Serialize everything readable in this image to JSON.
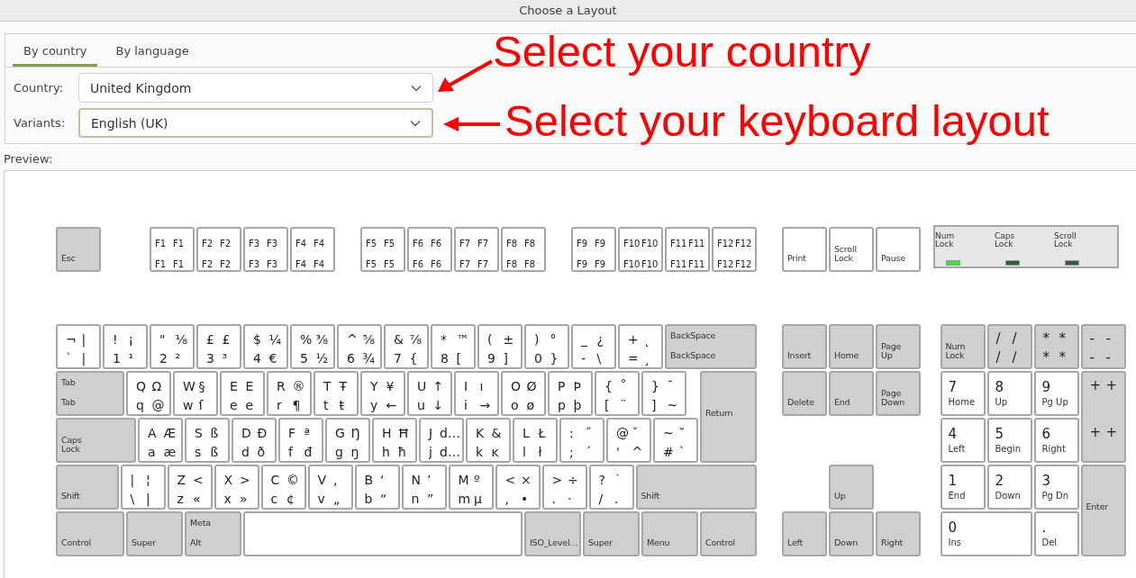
{
  "window": {
    "title": "Choose a Layout"
  },
  "tabs": [
    {
      "label": "By country",
      "selected": true
    },
    {
      "label": "By language",
      "selected": false
    }
  ],
  "fields": [
    {
      "label": "Country:",
      "value": "United Kingdom",
      "focused": false
    },
    {
      "label": "Variants:",
      "value": "English (UK)",
      "focused": true
    }
  ],
  "annotations": [
    {
      "text": "Select your country"
    },
    {
      "text": "Select your keyboard layout"
    }
  ],
  "preview": {
    "label": "Preview:"
  },
  "keyboard": {
    "function_keys": [
      {
        "kind": "mod",
        "lower": "Esc"
      },
      {
        "kind": "fkey",
        "upper": "F1",
        "upper_alt": "F1",
        "lower": "F1",
        "lower_alt": "F1"
      },
      {
        "kind": "fkey",
        "upper": "F2",
        "upper_alt": "F2",
        "lower": "F2",
        "lower_alt": "F2"
      },
      {
        "kind": "fkey",
        "upper": "F3",
        "upper_alt": "F3",
        "lower": "F3",
        "lower_alt": "F3"
      },
      {
        "kind": "fkey",
        "upper": "F4",
        "upper_alt": "F4",
        "lower": "F4",
        "lower_alt": "F4"
      },
      {
        "kind": "fkey",
        "upper": "F5",
        "upper_alt": "F5",
        "lower": "F5",
        "lower_alt": "F5"
      },
      {
        "kind": "fkey",
        "upper": "F6",
        "upper_alt": "F6",
        "lower": "F6",
        "lower_alt": "F6"
      },
      {
        "kind": "fkey",
        "upper": "F7",
        "upper_alt": "F7",
        "lower": "F7",
        "lower_alt": "F7"
      },
      {
        "kind": "fkey",
        "upper": "F8",
        "upper_alt": "F8",
        "lower": "F8",
        "lower_alt": "F8"
      },
      {
        "kind": "fkey",
        "upper": "F9",
        "upper_alt": "F9",
        "lower": "F9",
        "lower_alt": "F9"
      },
      {
        "kind": "fkey",
        "upper": "F10",
        "upper_alt": "F10",
        "lower": "F10",
        "lower_alt": "F10"
      },
      {
        "kind": "fkey",
        "upper": "F11",
        "upper_alt": "F11",
        "lower": "F11",
        "lower_alt": "F11"
      },
      {
        "kind": "fkey",
        "upper": "F12",
        "upper_alt": "F12",
        "lower": "F12",
        "lower_alt": "F12"
      },
      {
        "kind": "label",
        "lower": "Print"
      },
      {
        "kind": "label",
        "lower": "Scroll Lock"
      },
      {
        "kind": "label",
        "lower": "Pause"
      }
    ],
    "leds": [
      {
        "label": "Num Lock",
        "on": true
      },
      {
        "label": "Caps Lock",
        "on": false
      },
      {
        "label": "Scroll Lock",
        "on": false
      }
    ],
    "main_rows": [
      [
        {
          "kind": "char",
          "upper": "¬",
          "upper_alt": "|",
          "lower": "`",
          "lower_alt": "|"
        },
        {
          "kind": "char",
          "upper": "!",
          "upper_alt": "¡",
          "lower": "1",
          "lower_alt": "¹"
        },
        {
          "kind": "char",
          "upper": "\"",
          "upper_alt": "⅛",
          "lower": "2",
          "lower_alt": "²"
        },
        {
          "kind": "char",
          "upper": "£",
          "upper_alt": "£",
          "lower": "3",
          "lower_alt": "³"
        },
        {
          "kind": "char",
          "upper": "$",
          "upper_alt": "¼",
          "lower": "4",
          "lower_alt": "€"
        },
        {
          "kind": "char",
          "upper": "%",
          "upper_alt": "⅜",
          "lower": "5",
          "lower_alt": "½"
        },
        {
          "kind": "char",
          "upper": "^",
          "upper_alt": "⅝",
          "lower": "6",
          "lower_alt": "¾"
        },
        {
          "kind": "char",
          "upper": "&",
          "upper_alt": "⅞",
          "lower": "7",
          "lower_alt": "{"
        },
        {
          "kind": "char",
          "upper": "*",
          "upper_alt": "™",
          "lower": "8",
          "lower_alt": "["
        },
        {
          "kind": "char",
          "upper": "(",
          "upper_alt": "±",
          "lower": "9",
          "lower_alt": "]"
        },
        {
          "kind": "char",
          "upper": ")",
          "upper_alt": "°",
          "lower": "0",
          "lower_alt": "}"
        },
        {
          "kind": "char",
          "upper": "_",
          "upper_alt": "¿",
          "lower": "-",
          "lower_alt": "\\"
        },
        {
          "kind": "char",
          "upper": "+",
          "upper_alt": "˛",
          "lower": "=",
          "lower_alt": "¸"
        },
        {
          "kind": "mod",
          "upper": "BackSpace",
          "lower": "BackSpace"
        }
      ],
      [
        {
          "kind": "mod",
          "upper": "Tab",
          "lower": "Tab"
        },
        {
          "kind": "char",
          "upper": "Q",
          "upper_alt": "Ω",
          "lower": "q",
          "lower_alt": "@"
        },
        {
          "kind": "char",
          "upper": "W",
          "upper_alt": "§",
          "lower": "w",
          "lower_alt": "ſ"
        },
        {
          "kind": "char",
          "upper": "E",
          "upper_alt": "E",
          "lower": "e",
          "lower_alt": "e"
        },
        {
          "kind": "char",
          "upper": "R",
          "upper_alt": "®",
          "lower": "r",
          "lower_alt": "¶"
        },
        {
          "kind": "char",
          "upper": "T",
          "upper_alt": "Ŧ",
          "lower": "t",
          "lower_alt": "ŧ"
        },
        {
          "kind": "char",
          "upper": "Y",
          "upper_alt": "¥",
          "lower": "y",
          "lower_alt": "←"
        },
        {
          "kind": "char",
          "upper": "U",
          "upper_alt": "↑",
          "lower": "u",
          "lower_alt": "↓"
        },
        {
          "kind": "char",
          "upper": "I",
          "upper_alt": "ı",
          "lower": "i",
          "lower_alt": "→"
        },
        {
          "kind": "char",
          "upper": "O",
          "upper_alt": "Ø",
          "lower": "o",
          "lower_alt": "ø"
        },
        {
          "kind": "char",
          "upper": "P",
          "upper_alt": "Þ",
          "lower": "p",
          "lower_alt": "þ"
        },
        {
          "kind": "char",
          "upper": "{",
          "upper_alt": "˚",
          "lower": "[",
          "lower_alt": "¨"
        },
        {
          "kind": "char",
          "upper": "}",
          "upper_alt": "¯",
          "lower": "]",
          "lower_alt": "~"
        },
        {
          "kind": "mod",
          "lower": "Return"
        }
      ],
      [
        {
          "kind": "mod",
          "lower": "Caps Lock"
        },
        {
          "kind": "char",
          "upper": "A",
          "upper_alt": "Æ",
          "lower": "a",
          "lower_alt": "æ"
        },
        {
          "kind": "char",
          "upper": "S",
          "upper_alt": "ß",
          "lower": "s",
          "lower_alt": "ß"
        },
        {
          "kind": "char",
          "upper": "D",
          "upper_alt": "Ð",
          "lower": "d",
          "lower_alt": "ð"
        },
        {
          "kind": "char",
          "upper": "F",
          "upper_alt": "ª",
          "lower": "f",
          "lower_alt": "đ"
        },
        {
          "kind": "char",
          "upper": "G",
          "upper_alt": "Ŋ",
          "lower": "g",
          "lower_alt": "ŋ"
        },
        {
          "kind": "char",
          "upper": "H",
          "upper_alt": "Ħ",
          "lower": "h",
          "lower_alt": "ħ"
        },
        {
          "kind": "char",
          "upper": "J",
          "upper_alt": "d…",
          "lower": "j",
          "lower_alt": "d…"
        },
        {
          "kind": "char",
          "upper": "K",
          "upper_alt": "&",
          "lower": "k",
          "lower_alt": "ĸ"
        },
        {
          "kind": "char",
          "upper": "L",
          "upper_alt": "Ł",
          "lower": "l",
          "lower_alt": "ł"
        },
        {
          "kind": "char",
          "upper": ":",
          "upper_alt": "˝",
          "lower": ";",
          "lower_alt": "´"
        },
        {
          "kind": "char",
          "upper": "@",
          "upper_alt": "ˇ",
          "lower": "'",
          "lower_alt": "^"
        },
        {
          "kind": "char",
          "upper": "~",
          "upper_alt": "˘",
          "lower": "#",
          "lower_alt": "`"
        }
      ],
      [
        {
          "kind": "mod",
          "lower": "Shift"
        },
        {
          "kind": "char",
          "upper": "|",
          "upper_alt": "¦",
          "lower": "\\",
          "lower_alt": "|"
        },
        {
          "kind": "char",
          "upper": "Z",
          "upper_alt": "<",
          "lower": "z",
          "lower_alt": "«"
        },
        {
          "kind": "char",
          "upper": "X",
          "upper_alt": ">",
          "lower": "x",
          "lower_alt": "»"
        },
        {
          "kind": "char",
          "upper": "C",
          "upper_alt": "©",
          "lower": "c",
          "lower_alt": "¢"
        },
        {
          "kind": "char",
          "upper": "V",
          "upper_alt": "‚",
          "lower": "v",
          "lower_alt": "„"
        },
        {
          "kind": "char",
          "upper": "B",
          "upper_alt": "‘",
          "lower": "b",
          "lower_alt": "“"
        },
        {
          "kind": "char",
          "upper": "N",
          "upper_alt": "’",
          "lower": "n",
          "lower_alt": "”"
        },
        {
          "kind": "char",
          "upper": "M",
          "upper_alt": "º",
          "lower": "m",
          "lower_alt": "µ"
        },
        {
          "kind": "char",
          "upper": "<",
          "upper_alt": "×",
          "lower": ",",
          "lower_alt": "•"
        },
        {
          "kind": "char",
          "upper": ">",
          "upper_alt": "÷",
          "lower": ".",
          "lower_alt": "·"
        },
        {
          "kind": "char",
          "upper": "?",
          "upper_alt": "˙",
          "lower": "/",
          "lower_alt": "."
        },
        {
          "kind": "mod",
          "lower": "Shift"
        }
      ],
      [
        {
          "kind": "mod",
          "lower": "Control"
        },
        {
          "kind": "mod",
          "lower": "Super"
        },
        {
          "kind": "mod",
          "upper": "Meta",
          "lower": "Alt"
        },
        {
          "kind": "space"
        },
        {
          "kind": "mod",
          "lower": "ISO_Level…"
        },
        {
          "kind": "mod",
          "lower": "Super"
        },
        {
          "kind": "mod",
          "lower": "Menu"
        },
        {
          "kind": "mod",
          "lower": "Control"
        }
      ]
    ],
    "navigation_keys": [
      {
        "kind": "mod",
        "lower": "Insert"
      },
      {
        "kind": "mod",
        "lower": "Home"
      },
      {
        "kind": "mod",
        "lower": "Page Up"
      },
      {
        "kind": "mod",
        "lower": "Delete"
      },
      {
        "kind": "mod",
        "lower": "End"
      },
      {
        "kind": "mod",
        "lower": "Page Down"
      },
      {
        "kind": "mod",
        "lower": "Up"
      },
      {
        "kind": "mod",
        "lower": "Left"
      },
      {
        "kind": "mod",
        "lower": "Down"
      },
      {
        "kind": "mod",
        "lower": "Right"
      }
    ],
    "numpad_keys": [
      {
        "kind": "mod",
        "lower": "Num Lock"
      },
      {
        "kind": "op",
        "upper": "/",
        "upper_alt": "/",
        "lower": "/",
        "lower_alt": "/"
      },
      {
        "kind": "op",
        "upper": "*",
        "upper_alt": "*",
        "lower": "*",
        "lower_alt": "*"
      },
      {
        "kind": "op",
        "upper": "-",
        "upper_alt": "-",
        "lower": "-",
        "lower_alt": "-"
      },
      {
        "kind": "num",
        "upper": "7",
        "lower": "Home"
      },
      {
        "kind": "num",
        "upper": "8",
        "lower": "Up"
      },
      {
        "kind": "num",
        "upper": "9",
        "lower": "Pg Up"
      },
      {
        "kind": "op",
        "upper": "+",
        "upper_alt": "+",
        "lower": "+",
        "lower_alt": "+"
      },
      {
        "kind": "num",
        "upper": "4",
        "lower": "Left"
      },
      {
        "kind": "num",
        "upper": "5",
        "lower": "Begin"
      },
      {
        "kind": "num",
        "upper": "6",
        "lower": "Right"
      },
      {
        "kind": "num",
        "upper": "1",
        "lower": "End"
      },
      {
        "kind": "num",
        "upper": "2",
        "lower": "Down"
      },
      {
        "kind": "num",
        "upper": "3",
        "lower": "Pg Dn"
      },
      {
        "kind": "mod",
        "lower": "Enter"
      },
      {
        "kind": "num",
        "upper": "0",
        "lower": "Ins"
      },
      {
        "kind": "num",
        "upper": ".",
        "lower": "Del"
      }
    ]
  }
}
